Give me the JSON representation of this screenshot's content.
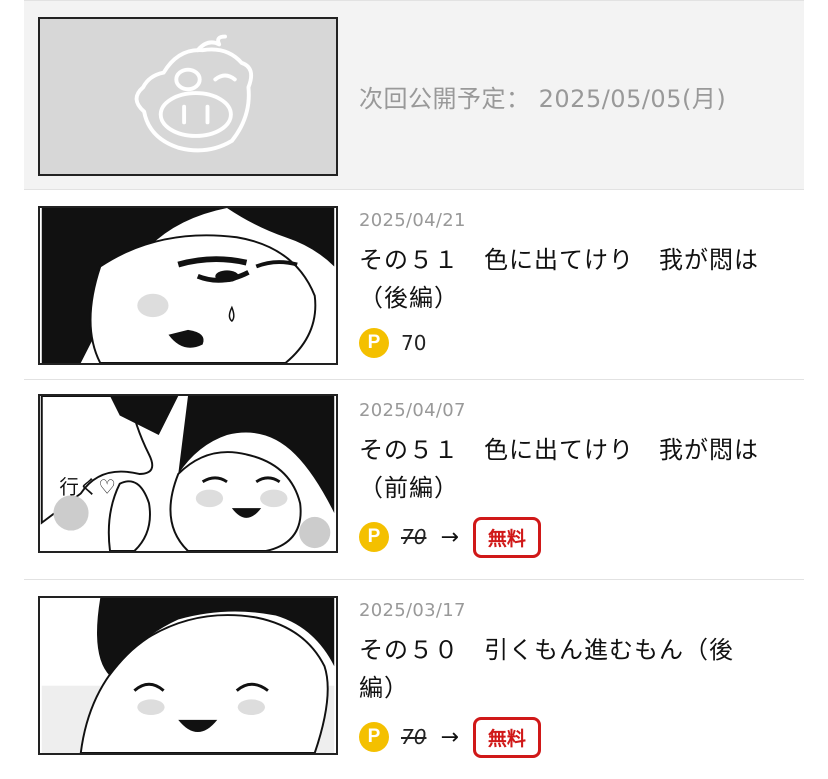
{
  "upcoming": {
    "label": "次回公開予定：",
    "date": "2025/05/05(月)",
    "thumb_icon": "pig-mascot-icon"
  },
  "episodes": [
    {
      "date": "2025/04/21",
      "title_line1": "その５１　色に出てけり　我が悶は",
      "title_line2": "（後編）",
      "coin_letter": "P",
      "price": "70",
      "free": false
    },
    {
      "date": "2025/04/07",
      "title_line1": "その５１　色に出てけり　我が悶は",
      "title_line2": "（前編）",
      "coin_letter": "P",
      "price": "70",
      "arrow": "→",
      "free_label": "無料",
      "free": true
    },
    {
      "date": "2025/03/17",
      "title_line1": "その５０　引くもん進むもん（後",
      "title_line2": "編）",
      "coin_letter": "P",
      "price": "70",
      "arrow": "→",
      "free_label": "無料",
      "free": true
    }
  ],
  "thumb_ep2_text": "行く♡",
  "colors": {
    "coin": "#f4c000",
    "free_badge": "#d01818",
    "muted_text": "#999999"
  }
}
